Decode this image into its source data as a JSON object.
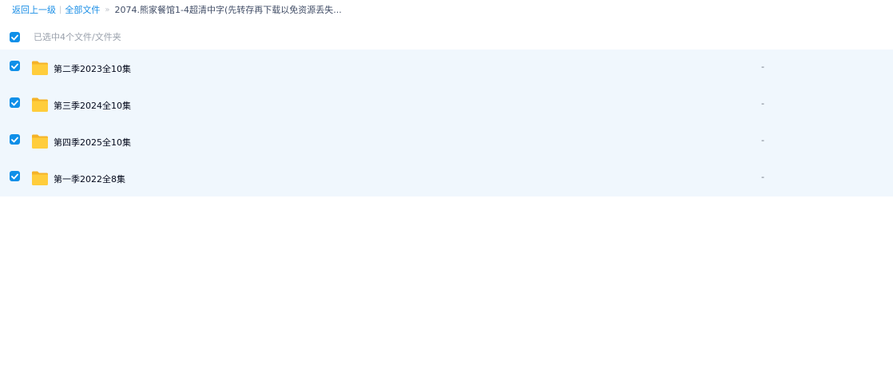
{
  "breadcrumb": {
    "back_label": "返回上一级",
    "separator": "|",
    "all_files_label": "全部文件",
    "arrow": "»",
    "current_label": "2074.熊家餐馆1-4超清中字(先转存再下载以免资源丢失..."
  },
  "selection": {
    "summary": "已选中4个文件/文件夹",
    "checked": true
  },
  "files": [
    {
      "name": "第二季2023全10集",
      "size": "-",
      "type": "folder",
      "checked": true
    },
    {
      "name": "第三季2024全10集",
      "size": "-",
      "type": "folder",
      "checked": true
    },
    {
      "name": "第四季2025全10集",
      "size": "-",
      "type": "folder",
      "checked": true
    },
    {
      "name": "第一季2022全8集",
      "size": "-",
      "type": "folder",
      "checked": true
    }
  ],
  "colors": {
    "accent": "#0f8fe8",
    "link": "#1a8ee6",
    "row_selected_bg": "#f0f7fd",
    "folder": "#ffc93a"
  },
  "icons": {
    "checkbox": "checkbox-checked-icon",
    "folder": "folder-icon"
  }
}
